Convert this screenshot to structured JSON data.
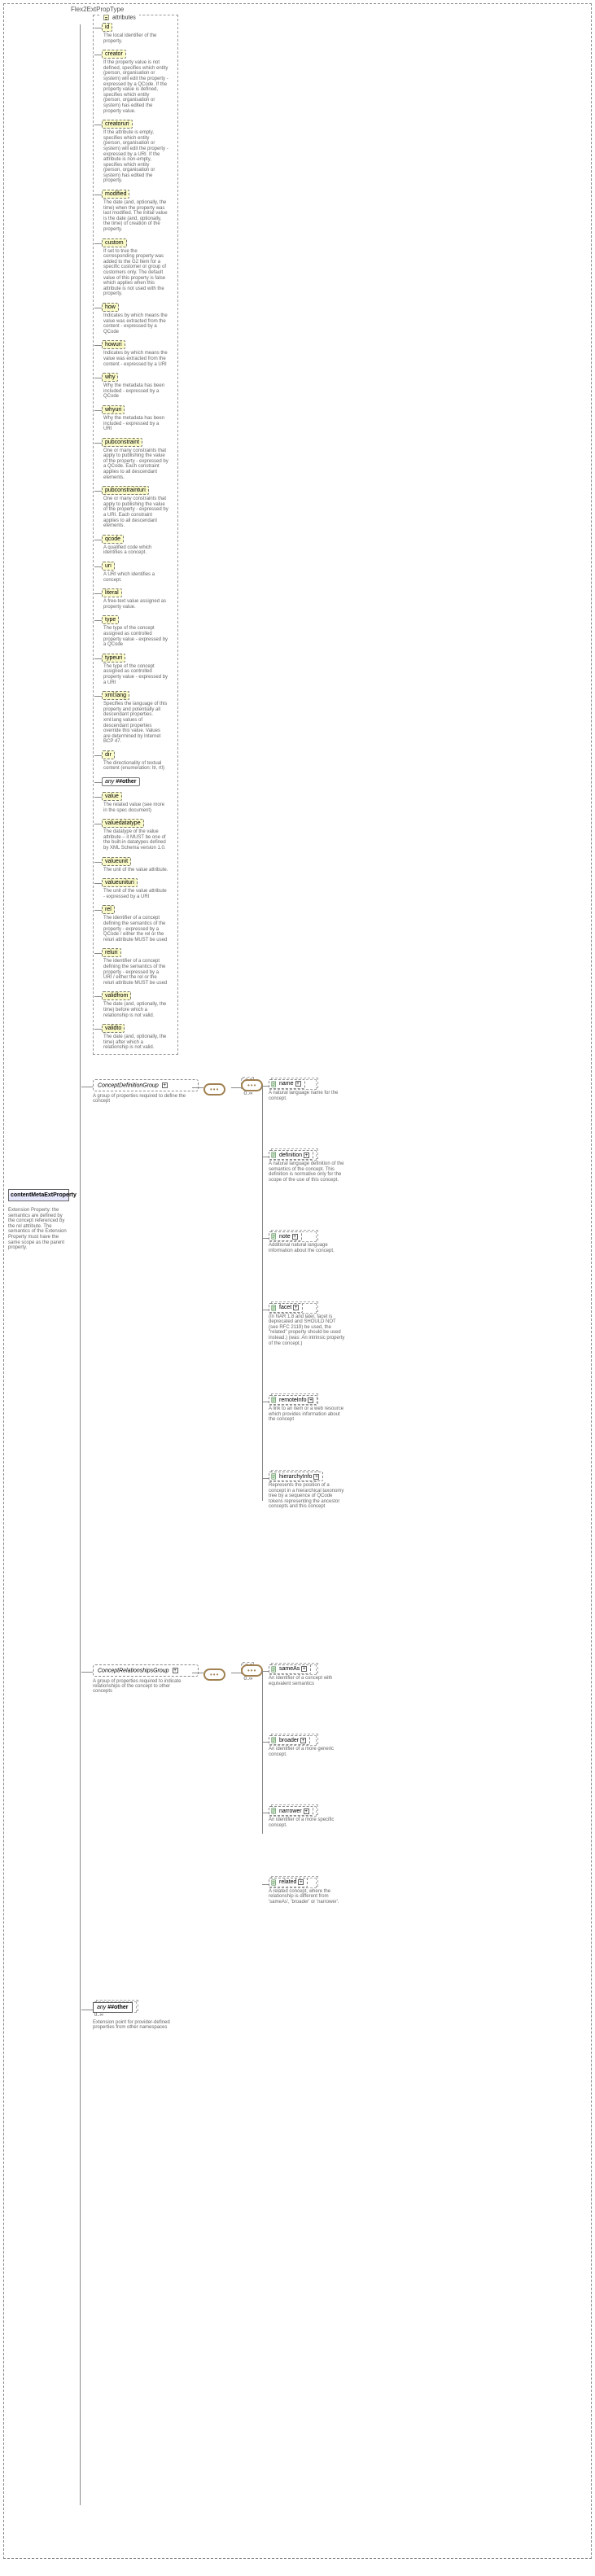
{
  "outerTitle": "Flex2ExtPropType",
  "root": {
    "label": "contentMetaExtProperty",
    "desc": "Extension Property: the semantics are defined by the concept referenced by the rel attribute. The semantics of the Extension Property must have the same scope as the parent property."
  },
  "attributesHeader": "attributes",
  "attributes": [
    {
      "name": "id",
      "desc": "The local identifier of the property.",
      "style": "dashed"
    },
    {
      "name": "creator",
      "desc": "If the property value is not defined, specifies which entity (person, organisation or system) will edit the property - expressed by a QCode. If the property value is defined, specifies which entity (person, organisation or system) has edited the property value.",
      "style": "dashed"
    },
    {
      "name": "creatoruri",
      "desc": "If the attribute is empty, specifies which entity (person, organisation or system) will edit the property - expressed by a URI. If the attribute is non-empty, specifies which entity (person, organisation or system) has edited the property.",
      "style": "dashed hatched"
    },
    {
      "name": "modified",
      "desc": "The date (and, optionally, the time) when the property was last modified. The initial value is the date (and, optionally, the time) of creation of the property.",
      "style": "dashed"
    },
    {
      "name": "custom",
      "desc": "If set to true the corresponding property was added to the G2 Item for a specific customer or group of customers only. The default value of this property is false which applies when this attribute is not used with the property.",
      "style": "dashed hatched"
    },
    {
      "name": "how",
      "desc": "Indicates by which means the value was extracted from the content - expressed by a QCode",
      "style": "dashed hatched"
    },
    {
      "name": "howuri",
      "desc": "Indicates by which means the value was extracted from the content - expressed by a URI",
      "style": "dashed hatched"
    },
    {
      "name": "why",
      "desc": "Why the metadata has been included - expressed by a QCode",
      "style": "dashed hatched"
    },
    {
      "name": "whyuri",
      "desc": "Why the metadata has been included - expressed by a URI",
      "style": "dashed hatched"
    },
    {
      "name": "pubconstraint",
      "desc": "One or many constraints that apply to publishing the value of the property - expressed by a QCode. Each constraint applies to all descendant elements.",
      "style": "dashed hatched"
    },
    {
      "name": "pubconstrainturi",
      "desc": "One or many constraints that apply to publishing the value of the property - expressed by a URI. Each constraint applies to all descendant elements.",
      "style": "dashed hatched"
    },
    {
      "name": "qcode",
      "desc": "A qualified code which identifies a concept.",
      "style": "dashed"
    },
    {
      "name": "uri",
      "desc": "A URI which identifies a concept.",
      "style": "dashed"
    },
    {
      "name": "literal",
      "desc": "A free-text value assigned as property value.",
      "style": "dashed"
    },
    {
      "name": "type",
      "desc": "The type of the concept assigned as controlled property value - expressed by a QCode",
      "style": "dashed"
    },
    {
      "name": "typeuri",
      "desc": "The type of the concept assigned as controlled property value - expressed by a URI",
      "style": "dashed hatched"
    },
    {
      "name": "xml:lang",
      "desc": "Specifies the language of this property and potentially all descendant properties. xml:lang values of descendant properties override this value. Values are determined by Internet BCP 47.",
      "style": "dashed hatched"
    },
    {
      "name": "dir",
      "desc": "The directionality of textual content (enumeration: ltr, rtl)",
      "style": "dashed"
    },
    {
      "name": "any ##other",
      "desc": "",
      "style": "solid any"
    },
    {
      "name": "value",
      "desc": "The related value (see more in the spec document)",
      "style": "dashed hatched"
    },
    {
      "name": "valuedatatype",
      "desc": "The datatype of the value attribute – it MUST be one of the built-in datatypes defined by XML Schema version 1.0.",
      "style": "dashed hatched"
    },
    {
      "name": "valueunit",
      "desc": "The unit of the value attribute.",
      "style": "dashed hatched"
    },
    {
      "name": "valueunituri",
      "desc": "The unit of the value attribute - expressed by a URI",
      "style": "dashed hatched"
    },
    {
      "name": "rel",
      "desc": "The identifier of a concept defining the semantics of the property - expressed by a QCode / either the rel or the reluri attribute MUST be used",
      "style": "dashed hatched"
    },
    {
      "name": "reluri",
      "desc": "The identifier of a concept defining the semantics of the property - expressed by a URI / either the rel or the reluri attribute MUST be used",
      "style": "dashed hatched"
    },
    {
      "name": "validfrom",
      "desc": "The date (and, optionally, the time) before which a relationship is not valid.",
      "style": "dashed hatched"
    },
    {
      "name": "validto",
      "desc": "The date (and, optionally, the time) after which a relationship is not valid.",
      "style": "dashed hatched"
    }
  ],
  "groups": [
    {
      "name": "ConceptDefinitionGroup",
      "desc": "A group of properties required to define the concept",
      "card": "0..∞",
      "children": [
        {
          "name": "name",
          "desc": "A natural language name for the concept."
        },
        {
          "name": "definition",
          "desc": "A natural language definition of the semantics of the concept. This definition is normative only for the scope of the use of this concept."
        },
        {
          "name": "note",
          "desc": "Additional natural language information about the concept."
        },
        {
          "name": "facet",
          "desc": "(In NAR 1.8 and later, facet is deprecated and SHOULD NOT (see RFC 2119) be used, the \"related\" property should be used instead.) (was: An intrinsic property of the concept.)"
        },
        {
          "name": "remoteInfo",
          "desc": "A link to an item or a web resource which provides information about the concept"
        },
        {
          "name": "hierarchyInfo",
          "desc": "Represents the position of a concept in a hierarchical taxonomy tree by a sequence of QCode tokens representing the ancestor concepts and this concept"
        }
      ]
    },
    {
      "name": "ConceptRelationshipsGroup",
      "desc": "A group of properties required to indicate relationships of the concept to other concepts",
      "card": "0..∞",
      "children": [
        {
          "name": "sameAs",
          "desc": "An identifier of a concept with equivalent semantics"
        },
        {
          "name": "broader",
          "desc": "An identifier of a more generic concept."
        },
        {
          "name": "narrower",
          "desc": "An identifier of a more specific concept."
        },
        {
          "name": "related",
          "desc": "A related concept, where the relationship is different from 'sameAs', 'broader' or 'narrower'."
        }
      ]
    }
  ],
  "extPoint": {
    "name": "any ##other",
    "desc": "Extension point for provider-defined properties from other namespaces",
    "card": "0..∞"
  }
}
